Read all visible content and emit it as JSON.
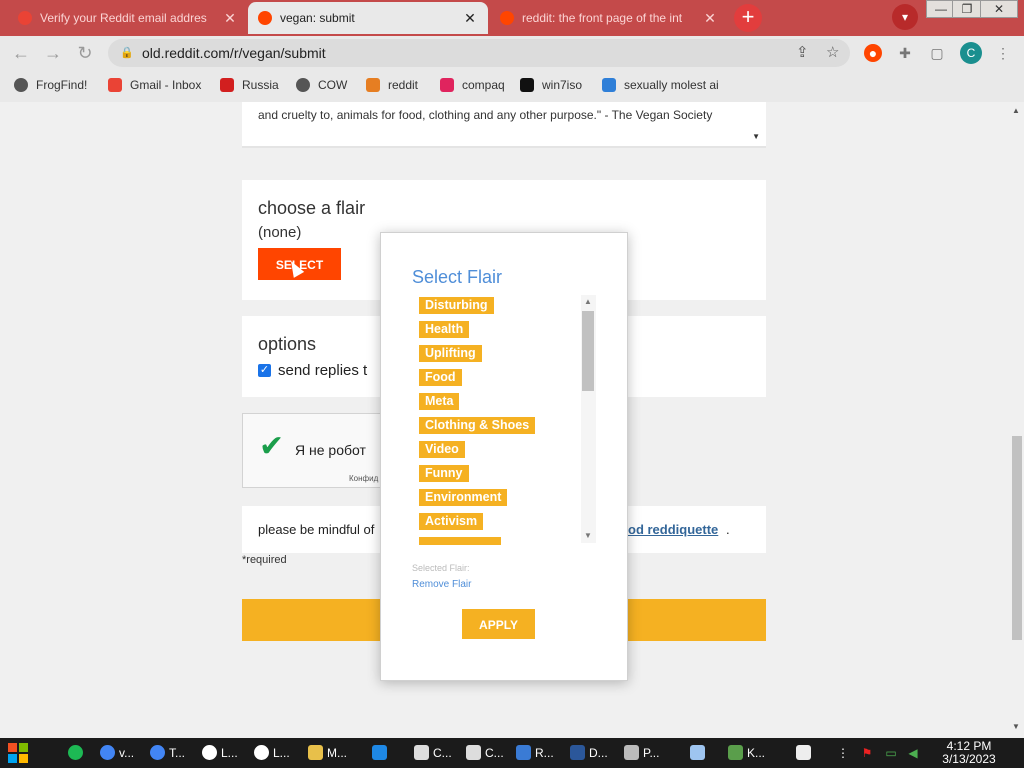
{
  "browser": {
    "tabs": [
      {
        "title": "Verify your Reddit email addres",
        "active": false
      },
      {
        "title": "vegan: submit",
        "active": true
      },
      {
        "title": "reddit: the front page of the int",
        "active": false
      }
    ],
    "url": "old.reddit.com/r/vegan/submit",
    "profile_initial": "C",
    "bookmarks": [
      "FrogFind!",
      "Gmail - Inbox",
      "Russia",
      "COW",
      "reddit",
      "compaq",
      "win7iso",
      "sexually molest ai"
    ]
  },
  "page": {
    "description_text": "and cruelty to, animals for food, clothing and any other purpose.\" - The Vegan Society",
    "flair_heading": "choose a flair",
    "flair_current": "(none)",
    "select_label": "SELECT",
    "options_heading": "options",
    "options_checkbox_label": "send replies t",
    "captcha_text": "Я не робот",
    "captcha_small": "Конфид",
    "mindful_text": "please be mindful of",
    "mindful_link": "od reddiquette",
    "mindful_dot": ".",
    "required_note": "*required"
  },
  "modal": {
    "title": "Select Flair",
    "flairs": [
      "Disturbing",
      "Health",
      "Uplifting",
      "Food",
      "Meta",
      "Clothing & Shoes",
      "Video",
      "Funny",
      "Environment",
      "Activism"
    ],
    "selected_label": "Selected Flair:",
    "remove_label": "Remove Flair",
    "apply_label": "APPLY",
    "accent_color": "#f5b122",
    "title_color": "#4f8ed8"
  },
  "taskbar": {
    "items": [
      "v...",
      "T...",
      "L...",
      "L...",
      "M...",
      "C...",
      "C...",
      "R...",
      "D...",
      "P...",
      "K..."
    ],
    "time": "4:12 PM",
    "date": "3/13/2023"
  }
}
